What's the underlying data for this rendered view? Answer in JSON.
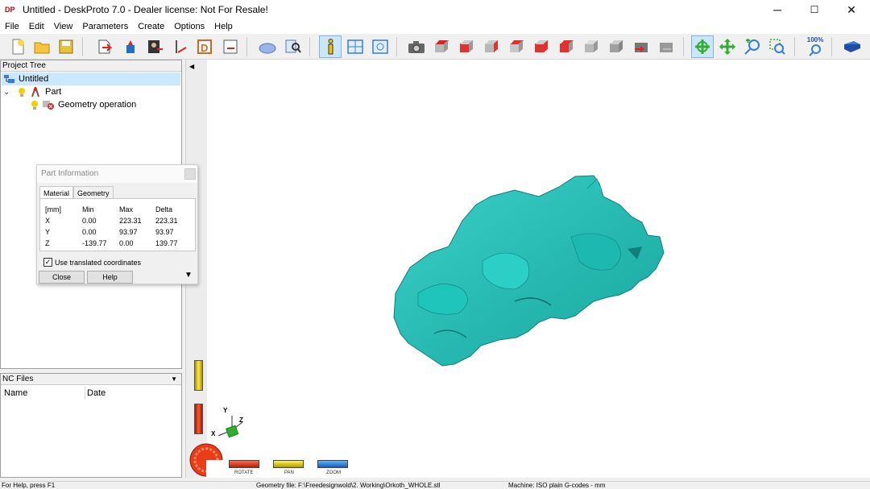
{
  "window": {
    "title": "Untitled - DeskProto 7.0 - Dealer license: Not For Resale!",
    "app_icon_text": "DP",
    "controls": {
      "minimize": "─",
      "maximize": "☐",
      "close": "✕"
    }
  },
  "menu": [
    "File",
    "Edit",
    "View",
    "Parameters",
    "Create",
    "Options",
    "Help"
  ],
  "toolbar": {
    "zoom_label": "100%",
    "colors": {
      "active_bg": "#cde6f7",
      "cube_red": "#e53030",
      "cube_grey": "#b8b8b8",
      "green_arrows": "#2fae2f"
    }
  },
  "project_tree": {
    "header": "Project Tree",
    "root": "Untitled",
    "part": "Part",
    "operation": "Geometry operation"
  },
  "nc_files": {
    "header": "NC Files",
    "columns": [
      "Name",
      "Date"
    ]
  },
  "part_info": {
    "title": "Part Information",
    "tabs": [
      "Material",
      "Geometry"
    ],
    "table": {
      "headers": [
        "[mm]",
        "Min",
        "Max",
        "Delta"
      ],
      "rows": [
        [
          "X",
          "0.00",
          "223.31",
          "223.31"
        ],
        [
          "Y",
          "0.00",
          "93.97",
          "93.97"
        ],
        [
          "Z",
          "-139.77",
          "0.00",
          "139.77"
        ]
      ]
    },
    "checkbox_label": "Use translated coordinates",
    "checkbox_checked": true,
    "close_button": "Close",
    "help_button": "Help"
  },
  "viewport": {
    "model_color": "#20b2aa",
    "axes": {
      "x": "X",
      "y": "Y",
      "z": "Z"
    },
    "modes": [
      "ROTATE",
      "PAN",
      "ZOOM"
    ]
  },
  "status": {
    "help": "For Help, press F1",
    "geometry": "Geometry file: F:\\Freedesignwold\\2. Working\\Orkoth_WHOLE.stl",
    "machine": "Machine: ISO plain G-codes - mm"
  }
}
